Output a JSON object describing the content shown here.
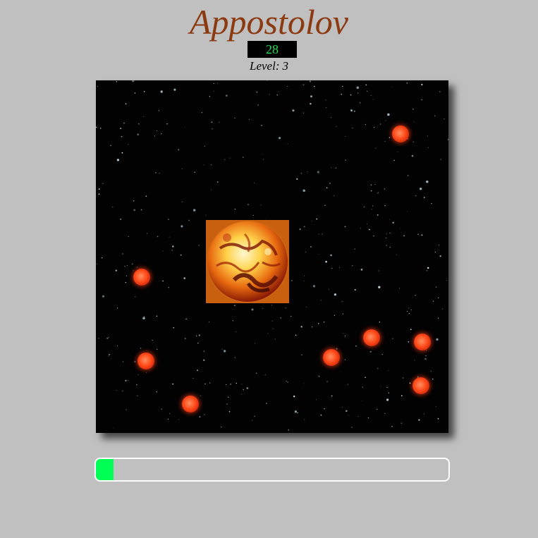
{
  "game": {
    "title": "Appostolov",
    "score": "28",
    "level_label": "Level:",
    "level_value": "3"
  },
  "progress": {
    "fraction": 0.05
  },
  "colors": {
    "background": "#c0c0c0",
    "title": "#8b3a12",
    "score_text": "#22dd55",
    "score_bg": "#000000",
    "arena_bg": "#020203",
    "meteor": "#ff4a1a",
    "progress_fill": "#00ff55",
    "progress_border": "#ffffff"
  },
  "sprites": {
    "player": "sun-player-icon",
    "enemy": "red-meteor-icon"
  }
}
